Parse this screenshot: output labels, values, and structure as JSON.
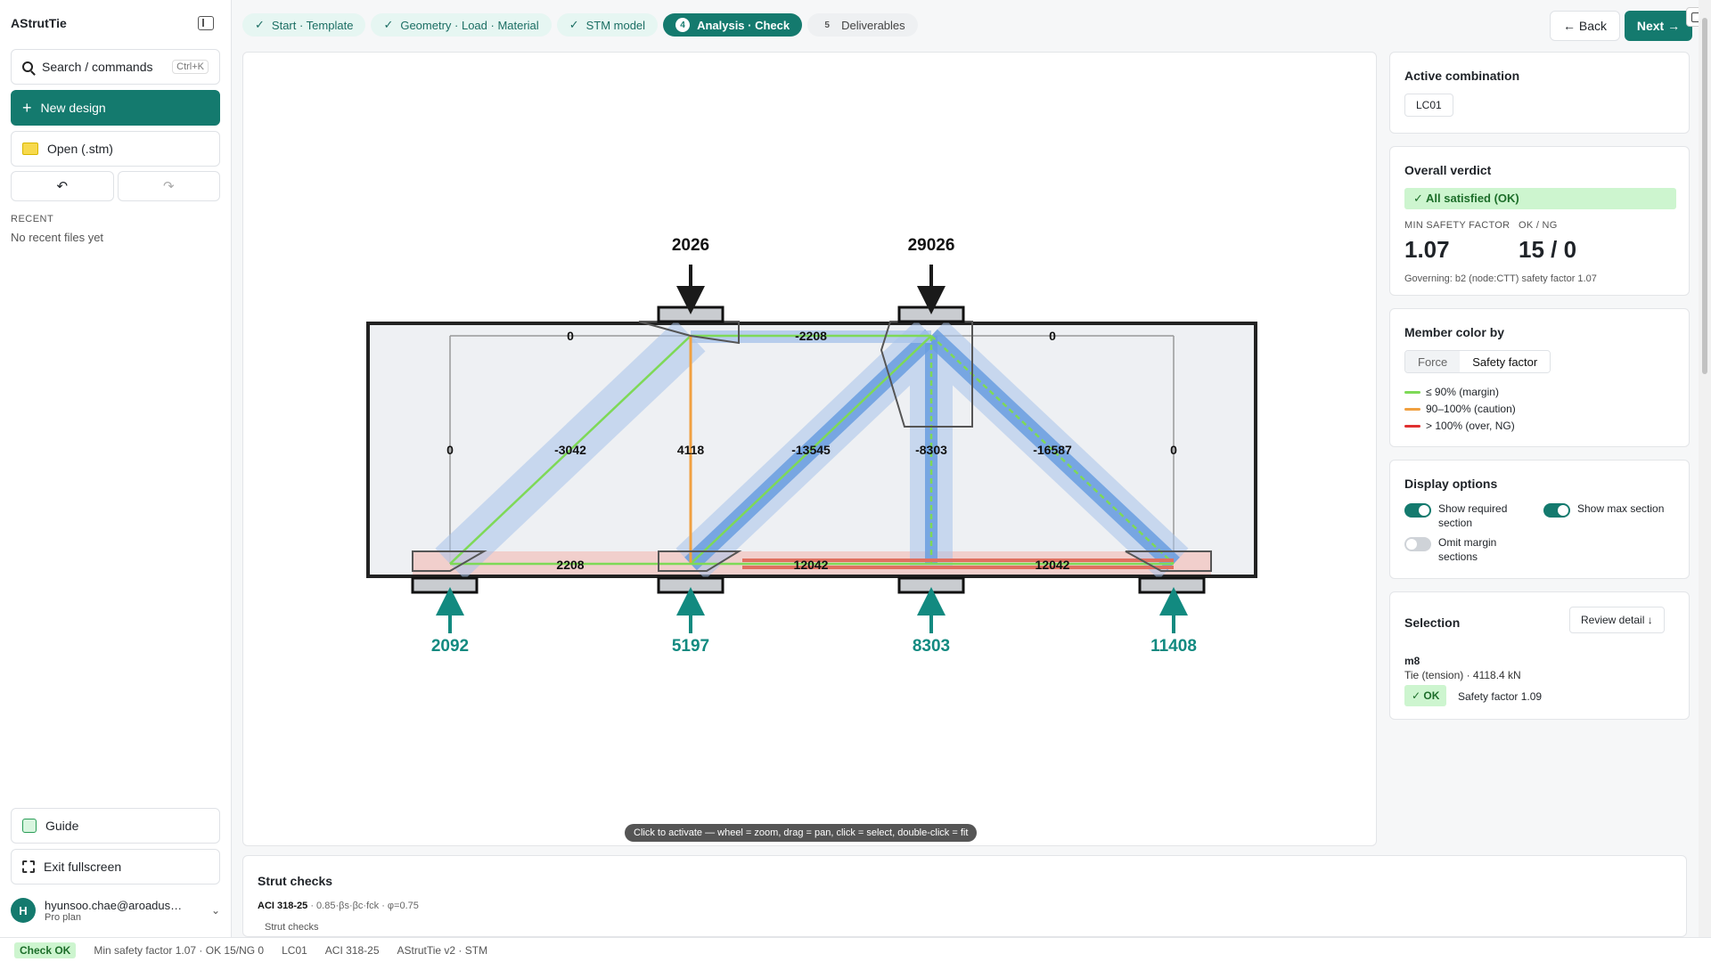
{
  "sidebar": {
    "brand": "AStrutTie",
    "search_label": "Search / commands",
    "search_shortcut": "Ctrl+K",
    "new_design": "New design",
    "open": "Open (.stm)",
    "undo": "↶",
    "redo": "↷",
    "recent_header": "RECENT",
    "recent_empty": "No recent files yet",
    "guide": "Guide",
    "exit_fullscreen": "Exit fullscreen",
    "user_initial": "H",
    "user_email": "hyunsoo.chae@aroadus…",
    "user_plan": "Pro plan",
    "user_chevron": "⌄"
  },
  "steps": [
    {
      "check": "✓",
      "label": "Start · Template"
    },
    {
      "check": "✓",
      "label": "Geometry · Load · Material"
    },
    {
      "check": "✓",
      "label": "STM model"
    },
    {
      "num": "4",
      "label": "Analysis · Check"
    },
    {
      "num": "5",
      "label": "Deliverables"
    }
  ],
  "nav": {
    "back": "← Back",
    "next": "Next →"
  },
  "canvas": {
    "hint": "Click to activate — wheel = zoom, drag = pan, click = select, double-click = fit",
    "top_loads": [
      "2026",
      "29026"
    ],
    "reactions": [
      "2092",
      "5197",
      "8303",
      "11408"
    ],
    "member_labels": [
      "0",
      "-2208",
      "0",
      "0",
      "-3042",
      "4118",
      "-13545",
      "-8303",
      "-16587",
      "0",
      "2208",
      "12042",
      "12042"
    ],
    "colors": {
      "ok": "#7ed957",
      "caution": "#f0a040",
      "over": "#e03030",
      "reaction": "#128a80"
    }
  },
  "strut_panel": {
    "title": "Strut checks",
    "code": "ACI 318-25",
    "formula": " · 0.85·βs·βc·fck · φ=0.75",
    "sub": "Strut checks"
  },
  "right": {
    "combination": {
      "title": "Active combination",
      "value": "LC01"
    },
    "verdict": {
      "title": "Overall verdict",
      "status": "✓ All satisfied (OK)",
      "min_sf_label": "MIN SAFETY FACTOR",
      "min_sf": "1.07",
      "okng_label": "OK / NG",
      "okng": "15 / 0",
      "governing": "Governing: b2 (node:CTT) safety factor 1.07"
    },
    "color_by": {
      "title": "Member color by",
      "options": [
        "Force",
        "Safety factor"
      ],
      "legend": [
        "≤ 90% (margin)",
        "90–100% (caution)",
        "> 100% (over, NG)"
      ]
    },
    "display": {
      "title": "Display options",
      "show_required": "Show required section",
      "show_max": "Show max section",
      "omit_margin": "Omit margin sections"
    },
    "selection": {
      "title": "Selection",
      "review": "Review detail ↓",
      "id": "m8",
      "desc": "Tie (tension) · 4118.4 kN",
      "badge": "✓ OK",
      "sf": "Safety factor 1.09"
    }
  },
  "status": {
    "badge": "Check OK",
    "summary": "Min safety factor 1.07 · OK 15/NG 0",
    "combo": "LC01",
    "code": "ACI 318-25",
    "app": "AStrutTie v2 · STM"
  }
}
